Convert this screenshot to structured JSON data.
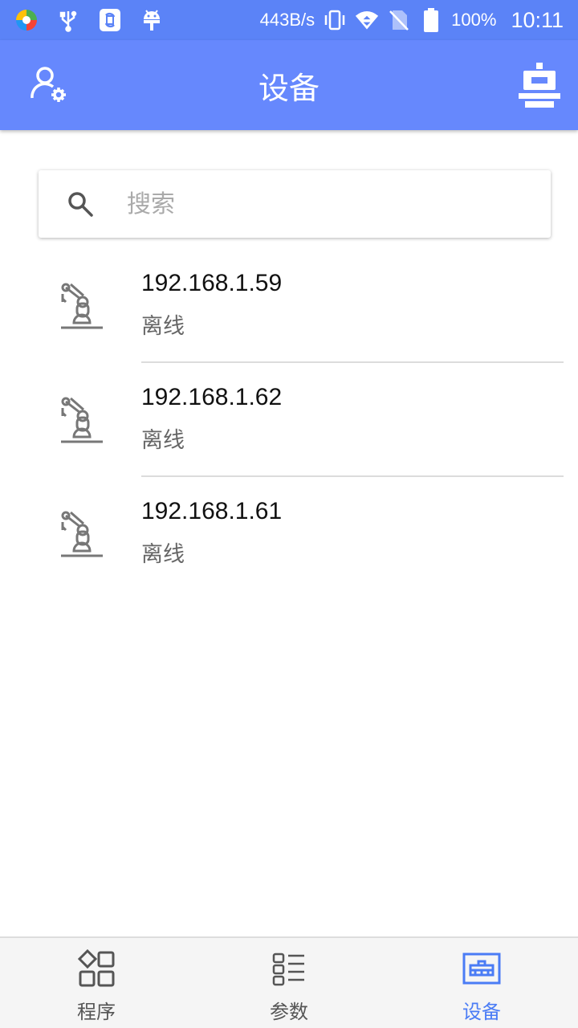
{
  "status_bar": {
    "network_speed": "443B/s",
    "battery": "100%",
    "time": "10:11",
    "icons": [
      "colorful-app-icon",
      "usb-icon",
      "sync-icon",
      "android-icon",
      "vibrate-icon",
      "wifi-icon",
      "no-sim-icon",
      "battery-icon"
    ]
  },
  "app_bar": {
    "title": "设备",
    "left_icon": "user-settings-icon",
    "right_icon": "device-terminal-icon"
  },
  "search": {
    "placeholder": "搜索",
    "value": "",
    "icon": "search-icon"
  },
  "devices": [
    {
      "ip": "192.168.1.59",
      "status": "离线",
      "icon": "robot-arm-icon"
    },
    {
      "ip": "192.168.1.62",
      "status": "离线",
      "icon": "robot-arm-icon"
    },
    {
      "ip": "192.168.1.61",
      "status": "离线",
      "icon": "robot-arm-icon"
    }
  ],
  "bottom_nav": {
    "items": [
      {
        "label": "程序",
        "icon": "program-grid-icon",
        "active": false
      },
      {
        "label": "参数",
        "icon": "params-list-icon",
        "active": false
      },
      {
        "label": "设备",
        "icon": "device-icon",
        "active": true
      }
    ]
  },
  "colors": {
    "status_bar": "#5b83f7",
    "app_bar": "#6688fd",
    "accent": "#4a7cf5",
    "icon_gray": "#777777"
  }
}
